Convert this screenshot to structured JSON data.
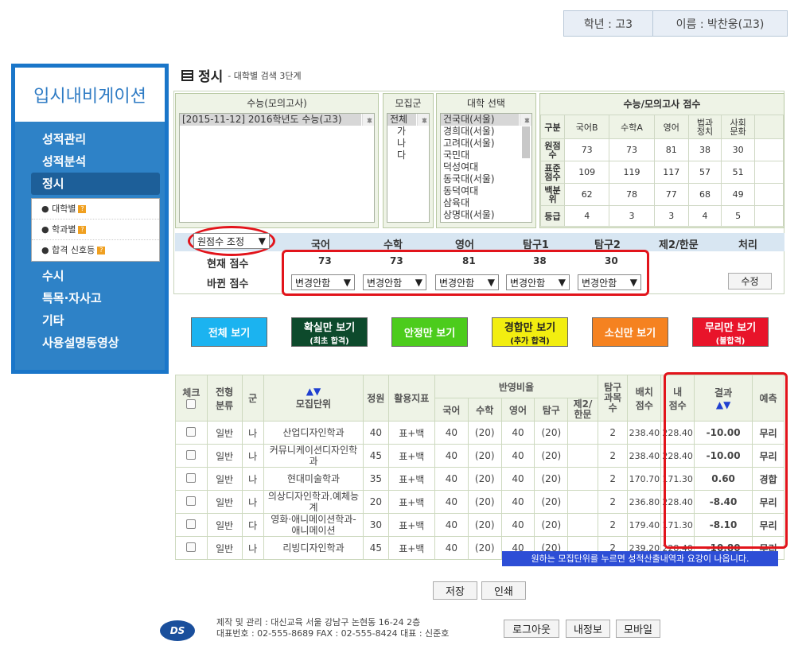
{
  "user": {
    "grade": "학년 : 고3",
    "name": "이름 : 박찬웅(고3)"
  },
  "sidebar": {
    "title": "입시내비게이션",
    "items": [
      {
        "label": "성적관리"
      },
      {
        "label": "성적분석"
      },
      {
        "label": "정시"
      },
      {
        "label": "수시"
      },
      {
        "label": "특목·자사고"
      },
      {
        "label": "기타"
      },
      {
        "label": "사용설명동영상"
      }
    ],
    "sub": [
      {
        "label": "대학별"
      },
      {
        "label": "학과별"
      },
      {
        "label": "합격 신호등"
      }
    ]
  },
  "page": {
    "title": "정시",
    "subtitle": "- 대학별 검색 3단계"
  },
  "exam": {
    "header": "수능(모의고사)",
    "selected": "[2015-11-12]  2016학년도 수능(고3)"
  },
  "group": {
    "header": "모집군",
    "options": [
      "전체",
      "가",
      "나",
      "다"
    ]
  },
  "univ": {
    "header": "대학 선택",
    "options": [
      "건국대(서울)",
      "경희대(서울)",
      "고려대(서울)",
      "국민대",
      "덕성여대",
      "동국대(서울)",
      "동덕여대",
      "삼육대",
      "상명대(서울)"
    ]
  },
  "scores": {
    "header": "수능/모의고사 점수",
    "col_header": "구분",
    "columns": [
      "국어B",
      "수학A",
      "영어",
      "법과\n정치",
      "사회\n문화"
    ],
    "rows": [
      {
        "label": "원점수",
        "values": [
          "73",
          "73",
          "81",
          "38",
          "30"
        ]
      },
      {
        "label": "표준점수",
        "values": [
          "109",
          "119",
          "117",
          "57",
          "51"
        ]
      },
      {
        "label": "백분위",
        "values": [
          "62",
          "78",
          "77",
          "68",
          "49"
        ]
      },
      {
        "label": "등급",
        "values": [
          "4",
          "3",
          "3",
          "4",
          "5"
        ]
      }
    ]
  },
  "adjust": {
    "dropdown": "원점수 조정",
    "subjects": [
      "국어",
      "수학",
      "영어",
      "탐구1",
      "탐구2",
      "제2/한문",
      "처리"
    ],
    "current_label": "현재 점수",
    "current": [
      "73",
      "73",
      "81",
      "38",
      "30"
    ],
    "changed_label": "바뀐 점수",
    "option": "변경안함",
    "apply": "수정"
  },
  "filters": [
    {
      "label": "전체 보기",
      "sub": "",
      "bg": "#1bb3f0",
      "fg": "#ffffff"
    },
    {
      "label": "확실만 보기",
      "sub": "(최초 합격)",
      "bg": "#0d4a2c",
      "fg": "#ffffff"
    },
    {
      "label": "안정만 보기",
      "sub": "",
      "bg": "#4ccc1c",
      "fg": "#ffffff"
    },
    {
      "label": "경합만 보기",
      "sub": "(추가 합격)",
      "bg": "#f2ee10",
      "fg": "#222222"
    },
    {
      "label": "소신만 보기",
      "sub": "",
      "bg": "#f58220",
      "fg": "#ffffff"
    },
    {
      "label": "무리만 보기",
      "sub": "(불합격)",
      "bg": "#e8142a",
      "fg": "#ffffff"
    }
  ],
  "results": {
    "headers": {
      "check": "체크",
      "type": "전형\n분류",
      "group": "군",
      "unit": "모집단위",
      "quota": "정원",
      "index": "활용지표",
      "ratio": "반영비율",
      "kor": "국어",
      "math": "수학",
      "eng": "영어",
      "tam": "탐구",
      "sec": "제2/\n한문",
      "tamcnt": "탐구\n과목\n수",
      "cutoff": "배치\n점수",
      "my": "내\n점수",
      "result": "결과",
      "pred": "예측"
    },
    "rows": [
      {
        "type": "일반",
        "group": "나",
        "unit": "산업디자인학과",
        "quota": "40",
        "index": "표+백",
        "kor": "40",
        "math": "(20)",
        "eng": "40",
        "tam": "(20)",
        "sec": "",
        "tamcnt": "2",
        "cutoff": "238.40",
        "my": "228.40",
        "result": "-10.00",
        "pred": "무리"
      },
      {
        "type": "일반",
        "group": "나",
        "unit": "커뮤니케이션디자인학과",
        "quota": "45",
        "index": "표+백",
        "kor": "40",
        "math": "(20)",
        "eng": "40",
        "tam": "(20)",
        "sec": "",
        "tamcnt": "2",
        "cutoff": "238.40",
        "my": "228.40",
        "result": "-10.00",
        "pred": "무리"
      },
      {
        "type": "일반",
        "group": "나",
        "unit": "현대미술학과",
        "quota": "35",
        "index": "표+백",
        "kor": "40",
        "math": "(20)",
        "eng": "40",
        "tam": "(20)",
        "sec": "",
        "tamcnt": "2",
        "cutoff": "170.70",
        "my": "171.30",
        "result": "0.60",
        "pred": "경합"
      },
      {
        "type": "일반",
        "group": "나",
        "unit": "의상디자인학과.예체능계",
        "quota": "20",
        "index": "표+백",
        "kor": "40",
        "math": "(20)",
        "eng": "40",
        "tam": "(20)",
        "sec": "",
        "tamcnt": "2",
        "cutoff": "236.80",
        "my": "228.40",
        "result": "-8.40",
        "pred": "무리"
      },
      {
        "type": "일반",
        "group": "다",
        "unit": "영화·애니메이션학과-애니메이션",
        "quota": "30",
        "index": "표+백",
        "kor": "40",
        "math": "(20)",
        "eng": "40",
        "tam": "(20)",
        "sec": "",
        "tamcnt": "2",
        "cutoff": "179.40",
        "my": "171.30",
        "result": "-8.10",
        "pred": "무리"
      },
      {
        "type": "일반",
        "group": "나",
        "unit": "리빙디자인학과",
        "quota": "45",
        "index": "표+백",
        "kor": "40",
        "math": "(20)",
        "eng": "40",
        "tam": "(20)",
        "sec": "",
        "tamcnt": "2",
        "cutoff": "239.20",
        "my": "228.40",
        "result": "-10.80",
        "pred": "무리"
      }
    ]
  },
  "notice": "원하는 모집단위를 누르면 성적산출내역과 요강이 나옵니다.",
  "actions": {
    "save": "저장",
    "print": "인쇄"
  },
  "footer": {
    "logo": "DS",
    "line1": "제작 및 관리 : 대신교육 서울 강남구 논현동 16-24 2층",
    "line2": "대표번호 : 02-555-8689   FAX : 02-555-8424   대표 : 신준호",
    "logout": "로그아웃",
    "myinfo": "내정보",
    "mobile": "모바일"
  }
}
